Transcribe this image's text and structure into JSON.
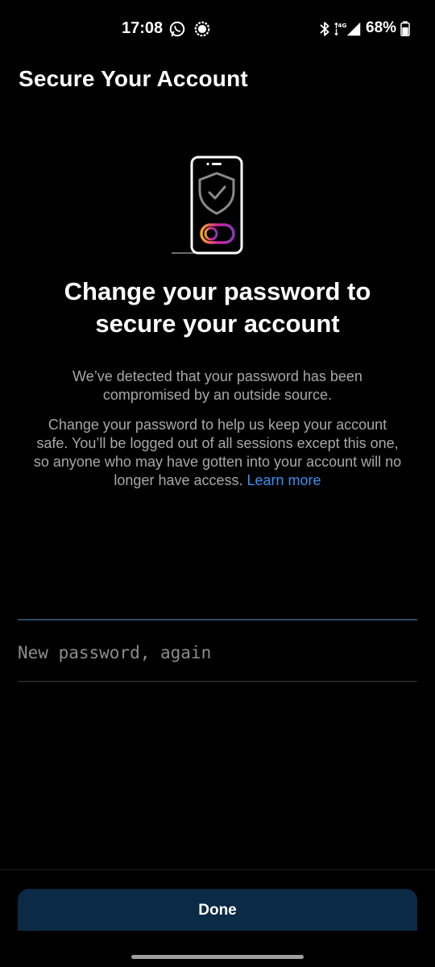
{
  "status_bar": {
    "time": "17:08",
    "left_icons": [
      "whatsapp-icon",
      "signal-app-icon"
    ],
    "right_icons": [
      "bluetooth-icon",
      "network-4g-icon",
      "signal-strength-icon"
    ],
    "battery_percent": "68%",
    "battery_level": 0.68
  },
  "header": {
    "title": "Secure Your Account"
  },
  "illustration": {
    "icon": "phone-shield-check-icon",
    "toggle_gradient": [
      "#f5a623",
      "#d6249f",
      "#833ab4"
    ]
  },
  "main": {
    "headline": "Change your password to secure your account",
    "paragraph1": "We’ve detected that your password has been compromised by an outside source.",
    "paragraph2": "Change your password to help us keep your account safe. You’ll be logged out of all sessions except this one, so anyone who may have gotten into your account will no longer have access.",
    "learn_more": "Learn more"
  },
  "form": {
    "confirm_password_placeholder": "New password, again",
    "confirm_password_value": ""
  },
  "footer": {
    "done_label": "Done"
  },
  "colors": {
    "background": "#000000",
    "link": "#3a8ff0",
    "button_bg": "#0b2a45",
    "muted_text": "#a8a8a8",
    "focused_divider": "#2f4a66"
  }
}
